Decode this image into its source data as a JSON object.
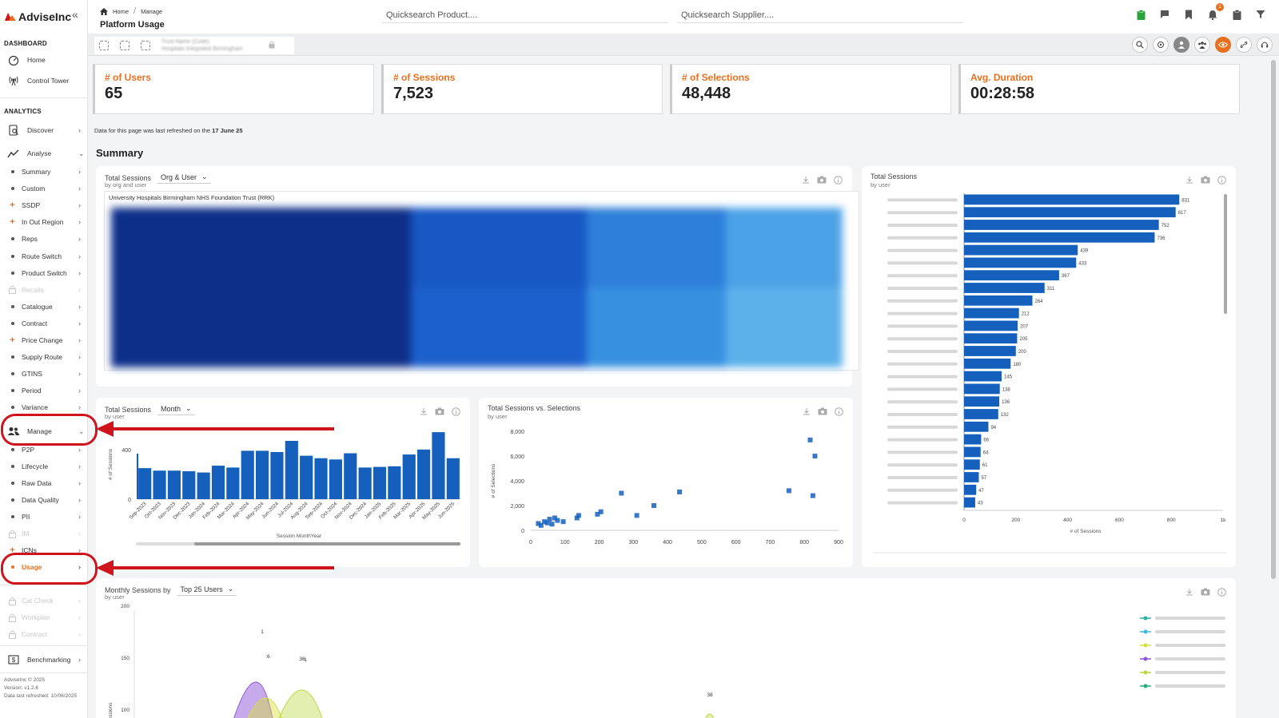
{
  "app": {
    "name": "AdviseInc",
    "collapse_icon": "«"
  },
  "sidebar": {
    "dashboard_title": "DASHBOARD",
    "dashboard_items": [
      {
        "label": "Home",
        "icon": "gauge-icon"
      },
      {
        "label": "Control Tower",
        "icon": "antenna-icon"
      }
    ],
    "analytics_title": "ANALYTICS",
    "discover": "Discover",
    "analyse": "Analyse",
    "analyse_items": [
      {
        "label": "Summary",
        "state": "normal",
        "marker": "dot"
      },
      {
        "label": "Custom",
        "state": "normal",
        "marker": "dot"
      },
      {
        "label": "SSDP",
        "state": "normal",
        "marker": "plus"
      },
      {
        "label": "In Out Region",
        "state": "normal",
        "marker": "plus"
      },
      {
        "label": "Reps",
        "state": "normal",
        "marker": "dot"
      },
      {
        "label": "Route Switch",
        "state": "normal",
        "marker": "dot"
      },
      {
        "label": "Product Switch",
        "state": "normal",
        "marker": "dot"
      },
      {
        "label": "Recalls",
        "state": "locked",
        "marker": "lock"
      },
      {
        "label": "Catalogue",
        "state": "normal",
        "marker": "dot"
      },
      {
        "label": "Contract",
        "state": "normal",
        "marker": "dot"
      },
      {
        "label": "Price Change",
        "state": "normal",
        "marker": "plus"
      },
      {
        "label": "Supply Route",
        "state": "normal",
        "marker": "dot"
      },
      {
        "label": "GTINS",
        "state": "normal",
        "marker": "dot"
      },
      {
        "label": "Period",
        "state": "normal",
        "marker": "dot"
      },
      {
        "label": "Variance",
        "state": "normal",
        "marker": "dot"
      }
    ],
    "manage": "Manage",
    "manage_items": [
      {
        "label": "P2P",
        "state": "normal",
        "marker": "dot"
      },
      {
        "label": "Lifecycle",
        "state": "normal",
        "marker": "dot"
      },
      {
        "label": "Raw Data",
        "state": "normal",
        "marker": "dot"
      },
      {
        "label": "Data Quality",
        "state": "normal",
        "marker": "dot"
      },
      {
        "label": "PII",
        "state": "normal",
        "marker": "dot"
      },
      {
        "label": "IM",
        "state": "locked",
        "marker": "lock"
      },
      {
        "label": "ICNs",
        "state": "normal",
        "marker": "plus"
      },
      {
        "label": "Usage",
        "state": "active",
        "marker": "dot"
      },
      {
        "label": "Cat Check",
        "state": "locked",
        "marker": "lock"
      },
      {
        "label": "Workplan",
        "state": "locked",
        "marker": "lock"
      },
      {
        "label": "Contract",
        "state": "locked",
        "marker": "lock"
      }
    ],
    "benchmarking": "Benchmarking",
    "footer": [
      "AdviseInc © 2025",
      "Version: v1.2.6",
      "Data last refreshed: 10/06/2025"
    ]
  },
  "header": {
    "breadcrumb": [
      "Home",
      "Manage"
    ],
    "page_title": "Platform Usage",
    "search_product_placeholder": "Quicksearch Product....",
    "search_supplier_placeholder": "Quicksearch Supplier....",
    "notification_count": "1",
    "icons": [
      "clipboard-icon",
      "flag-icon",
      "bookmark-icon",
      "bell-icon",
      "clipboard-list-icon",
      "filter-icon"
    ]
  },
  "toolbar": {
    "icons": [
      "select-icon",
      "expand-icon",
      "focus-icon"
    ],
    "blurred_name": "Trust Name (Code)",
    "blurred_sub": "Hospitals Integrated Birmingham"
  },
  "kpis": [
    {
      "label": "# of Users",
      "value": "65"
    },
    {
      "label": "# of Sessions",
      "value": "7,523"
    },
    {
      "label": "# of Selections",
      "value": "48,448"
    },
    {
      "label": "Avg. Duration",
      "value": "00:28:58"
    }
  ],
  "refresh_text": "Data for this page was last refreshed on the ",
  "refresh_date": "17 June 25",
  "summary_title": "Summary",
  "panels": {
    "treemap": {
      "title": "Total Sessions",
      "selector": "Org & User",
      "subtitle": "by org and user",
      "org_label": "University Hospitals Birmingham NHS Foundation Trust (RRK)"
    },
    "monthly": {
      "title": "Total Sessions",
      "selector": "Month",
      "subtitle": "by user"
    },
    "scatter": {
      "title": "Total Sessions vs. Selections",
      "subtitle": "by user"
    },
    "byuser": {
      "title": "Total Sessions",
      "subtitle": "by user"
    },
    "top25": {
      "title": "Monthly Sessions by",
      "selector": "Top  25 Users",
      "subtitle": "by user"
    }
  },
  "colors": {
    "accent": "#e8701f",
    "bar": "#1560bd",
    "dark_blue": "#0d2f8a",
    "annotation": "#d0141d"
  },
  "chart_data": [
    {
      "type": "bar",
      "title": "Total Sessions",
      "subtitle": "by user",
      "xlabel": "Session MonthYear",
      "ylabel": "# of Sessions",
      "yticks": [
        0,
        400
      ],
      "categories": [
        "Sep-2023",
        "Oct-2023",
        "Nov-2023",
        "Dec-2023",
        "Jan-2024",
        "Feb-2024",
        "Mar-2024",
        "Apr-2024",
        "May-2024",
        "Jun-2024",
        "Jul-2024",
        "Aug-2024",
        "Sep-2024",
        "Oct-2024",
        "Nov-2024",
        "Dec-2024",
        "Jan-2025",
        "Feb-2025",
        "Mar-2025",
        "Apr-2025",
        "May-2025",
        "Jun-2025"
      ],
      "values": [
        250,
        230,
        230,
        225,
        215,
        270,
        255,
        390,
        390,
        380,
        470,
        350,
        330,
        320,
        370,
        255,
        260,
        265,
        360,
        400,
        540,
        330
      ],
      "ylim": [
        0,
        560
      ]
    },
    {
      "type": "scatter",
      "title": "Total Sessions vs. Selections",
      "subtitle": "by user",
      "ylabel": "# of Selections",
      "xticks": [
        0,
        100,
        200,
        300,
        400,
        500,
        600,
        700,
        800,
        900
      ],
      "yticks": [
        "0",
        "2,000",
        "4,000",
        "6,000",
        "8,000"
      ],
      "xlim": [
        0,
        900
      ],
      "ylim": [
        0,
        8000
      ],
      "points": [
        [
          22,
          550
        ],
        [
          30,
          400
        ],
        [
          40,
          700
        ],
        [
          48,
          600
        ],
        [
          55,
          900
        ],
        [
          62,
          500
        ],
        [
          70,
          1000
        ],
        [
          78,
          800
        ],
        [
          95,
          700
        ],
        [
          135,
          1000
        ],
        [
          140,
          1200
        ],
        [
          195,
          1300
        ],
        [
          205,
          1500
        ],
        [
          265,
          3000
        ],
        [
          310,
          1200
        ],
        [
          360,
          2000
        ],
        [
          435,
          3100
        ],
        [
          755,
          3200
        ],
        [
          825,
          2800
        ],
        [
          831,
          6000
        ],
        [
          817,
          7300
        ]
      ]
    },
    {
      "type": "bar",
      "orientation": "horizontal",
      "title": "Total Sessions",
      "subtitle": "by user",
      "xlabel": "# of Sessions",
      "xticks": [
        "0",
        "200",
        "400",
        "600",
        "800",
        "1k"
      ],
      "xlim": [
        0,
        1000
      ],
      "values": [
        831,
        817,
        752,
        736,
        439,
        433,
        367,
        311,
        264,
        212,
        207,
        205,
        200,
        180,
        145,
        138,
        136,
        132,
        94,
        66,
        64,
        61,
        57,
        47,
        43
      ]
    },
    {
      "type": "area",
      "title": "Monthly Sessions by",
      "subtitle": "by user",
      "ylabel": "# of Sessions",
      "yticks": [
        100,
        150,
        200
      ],
      "ylim": [
        80,
        200
      ],
      "data_labels": [
        "1",
        ":6",
        "36",
        "1",
        ":",
        "38"
      ],
      "series_colors": [
        "#2bb3a4",
        "#3fb7e0",
        "#d5df3a",
        "#8e55d8",
        "#b9d83a",
        "#22b07d"
      ]
    }
  ]
}
